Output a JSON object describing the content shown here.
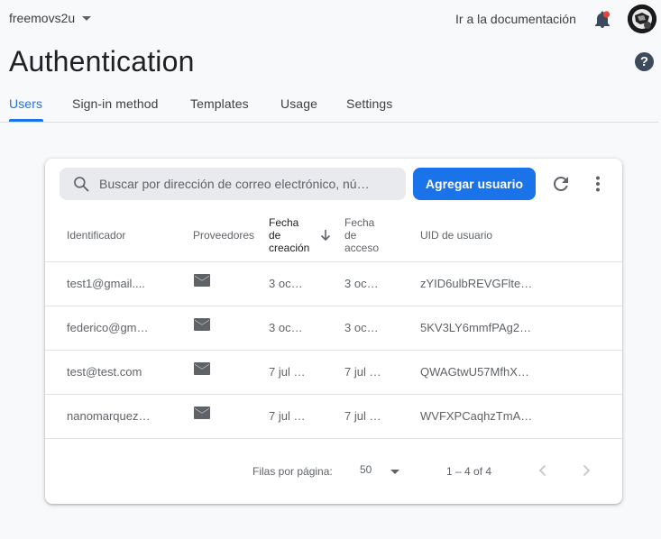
{
  "header": {
    "project_name": "freemovs2u",
    "docs_link": "Ir a la documentación",
    "title": "Authentication",
    "help_glyph": "?"
  },
  "tabs": [
    {
      "label": "Users",
      "active": true
    },
    {
      "label": "Sign-in method",
      "active": false
    },
    {
      "label": "Templates",
      "active": false
    },
    {
      "label": "Usage",
      "active": false
    },
    {
      "label": "Settings",
      "active": false
    }
  ],
  "toolbar": {
    "search_placeholder": "Buscar por dirección de correo electrónico, nú…",
    "add_user_label": "Agregar usuario"
  },
  "table": {
    "columns": {
      "identifier": "Identificador",
      "providers": "Proveedores",
      "created_line1": "Fecha",
      "created_line2": "de",
      "created_line3": "creación",
      "signed_in_line1": "Fecha",
      "signed_in_line2": "de",
      "signed_in_line3": "acceso",
      "uid": "UID de usuario"
    },
    "sorted_column": "created",
    "sort_direction": "descending",
    "rows": [
      {
        "identifier": "test1@gmail....",
        "provider": "mail-icon",
        "created": "3 oc…",
        "signed_in": "3 oc…",
        "uid": "zYID6ulbREVGFlte…"
      },
      {
        "identifier": "federico@gm…",
        "provider": "mail-icon",
        "created": "3 oc…",
        "signed_in": "3 oc…",
        "uid": "5KV3LY6mmfPAg2…"
      },
      {
        "identifier": "test@test.com",
        "provider": "mail-icon",
        "created": "7 jul …",
        "signed_in": "7 jul …",
        "uid": "QWAGtwU57MfhX…"
      },
      {
        "identifier": "nanomarquez…",
        "provider": "mail-icon",
        "created": "7 jul …",
        "signed_in": "7 jul …",
        "uid": "WVFXPCaqhzTmA…"
      }
    ]
  },
  "pagination": {
    "rows_per_page_label": "Filas por página:",
    "rows_per_page_value": "50",
    "range_label": "1 – 4 of 4"
  },
  "colors": {
    "accent": "#1a73e8",
    "notification": "#ea4335",
    "background": "#f8f9fa"
  }
}
